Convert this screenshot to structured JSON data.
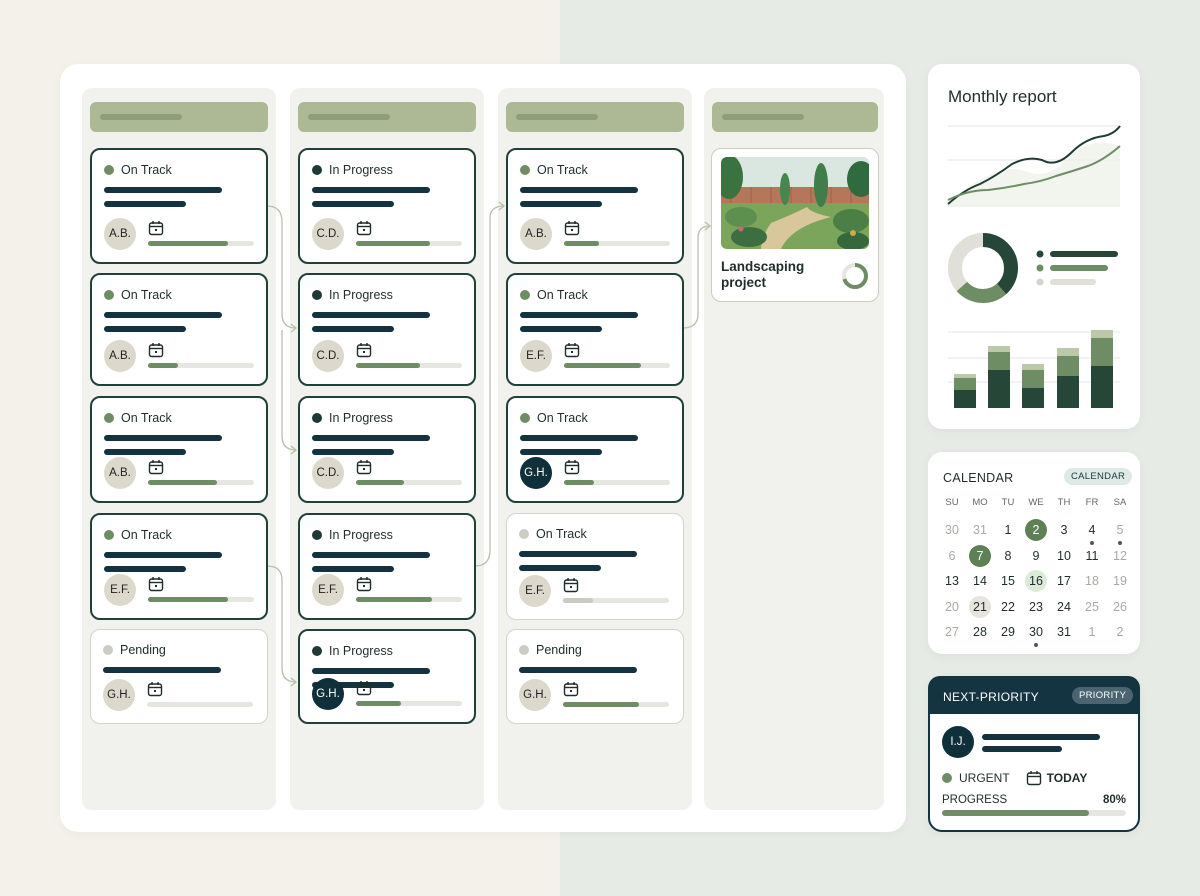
{
  "board": {
    "columns": [
      {
        "cards": [
          {
            "status": "On Track",
            "dot": "green",
            "initials": "A.B.",
            "progress": 0.75,
            "style": "dark"
          },
          {
            "status": "On Track",
            "dot": "green",
            "initials": "A.B.",
            "progress": 0.28,
            "style": "dark"
          },
          {
            "status": "On Track",
            "dot": "green",
            "initials": "A.B.",
            "progress": 0.65,
            "style": "dark"
          },
          {
            "status": "On Track",
            "dot": "green",
            "initials": "E.F.",
            "progress": 0.75,
            "style": "dark"
          },
          {
            "status": "Pending",
            "dot": "gray",
            "initials": "G.H.",
            "progress": 0.0,
            "style": "light"
          }
        ]
      },
      {
        "cards": [
          {
            "status": "In Progress",
            "dot": "dark",
            "initials": "C.D.",
            "progress": 0.7,
            "style": "dark"
          },
          {
            "status": "In Progress",
            "dot": "dark",
            "initials": "C.D.",
            "progress": 0.6,
            "style": "dark"
          },
          {
            "status": "In Progress",
            "dot": "dark",
            "initials": "C.D.",
            "progress": 0.45,
            "style": "dark"
          },
          {
            "status": "In Progress",
            "dot": "dark",
            "initials": "E.F.",
            "progress": 0.72,
            "style": "dark"
          },
          {
            "status": "In Progress",
            "dot": "dark",
            "initials": "G.H.",
            "progress": 0.42,
            "style": "dark",
            "avatar": "dark"
          }
        ]
      },
      {
        "cards": [
          {
            "status": "On Track",
            "dot": "green",
            "initials": "A.B.",
            "progress": 0.33,
            "style": "dark"
          },
          {
            "status": "On Track",
            "dot": "green",
            "initials": "E.F.",
            "progress": 0.73,
            "style": "dark"
          },
          {
            "status": "On Track",
            "dot": "green",
            "initials": "G.H.",
            "progress": 0.28,
            "style": "dark",
            "avatar": "dark"
          },
          {
            "status": "On Track",
            "dot": "gray",
            "initials": "E.F.",
            "progress": 0.28,
            "style": "light",
            "fill": "pale"
          },
          {
            "status": "Pending",
            "dot": "gray",
            "initials": "G.H.",
            "progress": 0.72,
            "style": "light"
          }
        ]
      }
    ],
    "project": {
      "title": "Landscaping project",
      "progress": 0.7
    }
  },
  "report": {
    "title": "Monthly report",
    "donut_share": 0.62,
    "colors": {
      "dark": "#264738",
      "mid": "#6f8d64",
      "light": "#bcc9a9",
      "pale": "#e1e0d8"
    }
  },
  "calendar": {
    "title": "CALENDAR",
    "badge": "CALENDAR",
    "weekdays": [
      "SU",
      "MO",
      "TU",
      "WE",
      "TH",
      "FR",
      "SA"
    ],
    "weeks": [
      [
        "30",
        "31",
        "1",
        "2",
        "3",
        "4",
        "5"
      ],
      [
        "6",
        "7",
        "8",
        "9",
        "10",
        "11",
        "12"
      ],
      [
        "13",
        "14",
        "15",
        "16",
        "17",
        "18",
        "19"
      ],
      [
        "20",
        "21",
        "22",
        "23",
        "24",
        "25",
        "26"
      ],
      [
        "27",
        "28",
        "29",
        "30",
        "31",
        "1",
        "2"
      ]
    ]
  },
  "next_priority": {
    "title": "NEXT-PRIORITY",
    "badge": "PRIORITY",
    "initials": "I.J.",
    "urgency": "URGENT",
    "due": "TODAY",
    "progress_label": "PROGRESS",
    "progress_value": "80%",
    "progress": 0.8
  }
}
